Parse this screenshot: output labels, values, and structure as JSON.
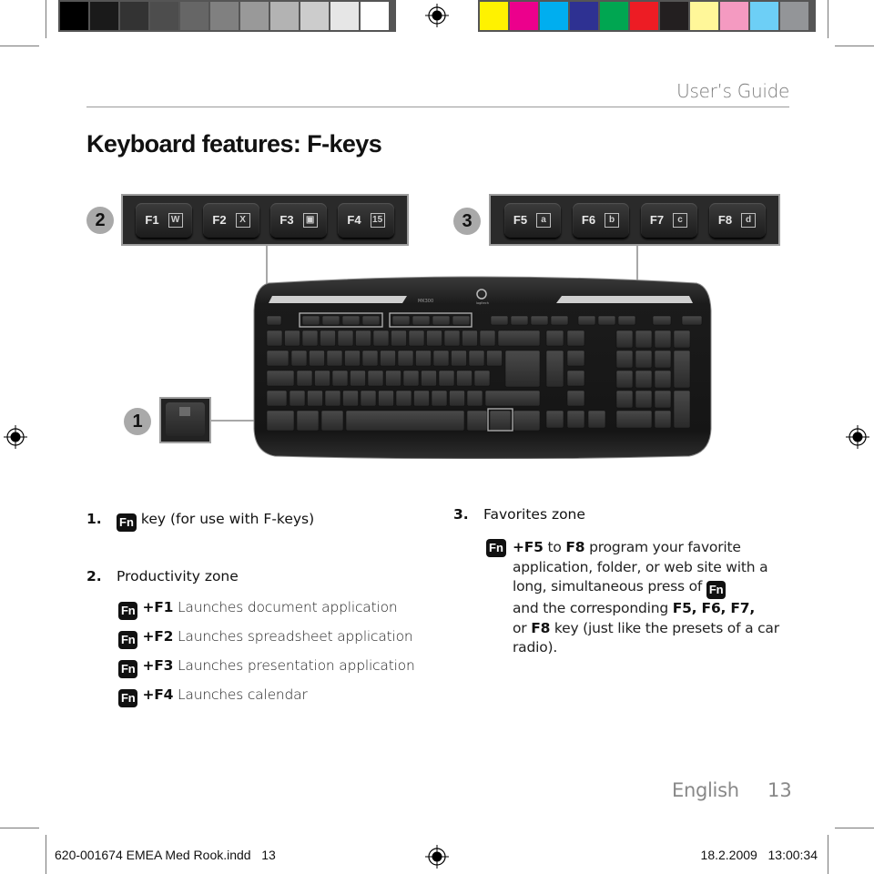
{
  "print_marks": {
    "grayscale_swatches": [
      "#000000",
      "#1a1a1a",
      "#333333",
      "#4d4d4d",
      "#666666",
      "#808080",
      "#999999",
      "#b3b3b3",
      "#cccccc",
      "#e6e6e6",
      "#ffffff"
    ],
    "color_swatches": [
      "#fff200",
      "#ec008c",
      "#00aeef",
      "#2e3192",
      "#00a651",
      "#ed1c24",
      "#231f20",
      "#fff799",
      "#f49ac1",
      "#6dcff6",
      "#939598"
    ]
  },
  "header": {
    "running_title": "User’s Guide",
    "page_title": "Keyboard features: F-keys"
  },
  "callouts": {
    "one": "1",
    "two": "2",
    "three": "3"
  },
  "productivity_keys": [
    {
      "label": "F1",
      "icon": "W",
      "icon_name": "document-icon"
    },
    {
      "label": "F2",
      "icon": "X",
      "icon_name": "spreadsheet-icon"
    },
    {
      "label": "F3",
      "icon": "▣",
      "icon_name": "presentation-icon"
    },
    {
      "label": "F4",
      "icon": "15",
      "icon_name": "calendar-icon"
    }
  ],
  "favorites_keys": [
    {
      "label": "F5",
      "icon": "a"
    },
    {
      "label": "F6",
      "icon": "b"
    },
    {
      "label": "F7",
      "icon": "c"
    },
    {
      "label": "F8",
      "icon": "d"
    }
  ],
  "keyboard": {
    "model": "MK300",
    "brand": "logitech"
  },
  "fn_label": "Fn",
  "items": {
    "item1": {
      "num": "1.",
      "text": "key (for use with F-keys)"
    },
    "item2": {
      "num": "2.",
      "title": "Productivity zone",
      "lines": [
        {
          "combo": "+F1",
          "desc": "Launches document application"
        },
        {
          "combo": "+F2",
          "desc": "Launches spreadsheet application"
        },
        {
          "combo": "+F3",
          "desc": "Launches presentation application"
        },
        {
          "combo": "+F4",
          "desc": "Launches calendar"
        }
      ]
    },
    "item3": {
      "num": "3.",
      "title": "Favorites zone",
      "p1_combo": "+F5",
      "p1_to": "to",
      "p1_f8": "F8",
      "p1_rest": "program your favorite application, folder, or web site with a long, simultaneous press of",
      "p2_pre": "and the corresponding",
      "p2_keys": "F5, F6, F7,",
      "p3_or": "or",
      "p3_f8": "F8",
      "p3_rest": "key (just like the presets of  a car radio)."
    }
  },
  "footer": {
    "language": "English",
    "page_number": "13",
    "slug_file": "620-001674 EMEA Med Rook.indd   13",
    "slug_date": "18.2.2009   13:00:34"
  }
}
